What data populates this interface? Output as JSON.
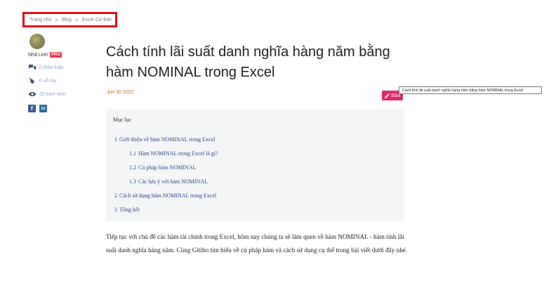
{
  "breadcrumb": {
    "items": [
      "Trang chủ",
      "Blog",
      "Excel Cơ Bản"
    ],
    "separator": ">"
  },
  "author": {
    "name": "Nhã Linh",
    "badge": "PRO",
    "stats": {
      "discussions": "0 thảo luận",
      "likes": "0 vỗ tay",
      "views": "25 lượt xem"
    },
    "social": {
      "facebook": "f",
      "linkedin": "in"
    }
  },
  "article": {
    "title": "Cách tính lãi suất danh nghĩa hàng năm bằng hàm NOMINAL trong Excel",
    "date": "Jun 30 2022",
    "edit_label": "Sửa",
    "tooltip": "Cách tính lãi suất danh nghĩa hàng năm bằng hàm NOMINAL trong Excel",
    "toc": {
      "heading": "Mục lục",
      "items": [
        {
          "num": "1",
          "label": "Giới thiệu về hàm NOMINAL trong Excel"
        },
        {
          "num": "1.1",
          "label": "Hàm NOMINAL trong Excel là gì?"
        },
        {
          "num": "1.2",
          "label": "Cú pháp hàm NOMINAL"
        },
        {
          "num": "1.3",
          "label": "Các lưu ý với hàm NOMINAL"
        },
        {
          "num": "2",
          "label": "Cách sử dụng hàm NOMINAL trong Excel"
        },
        {
          "num": "3",
          "label": "Tổng kết"
        }
      ]
    },
    "body": "Tiếp tục với chủ đề các hàm tài chính trong Excel, hôm nay chúng ta sẽ làm quen về hàm NOMINAL - hàm tính lãi suất danh nghĩa hàng năm. Cùng Gitiho tìm hiểu về cú pháp hàm và cách sử dụng cụ thể trong bài viết dưới đây nhé."
  },
  "colors": {
    "highlight_border": "#e0121b",
    "edit_button": "#d92b6b",
    "pro_badge": "#e0354a",
    "toc_link": "#2b4b8b",
    "date": "#b8742e"
  }
}
